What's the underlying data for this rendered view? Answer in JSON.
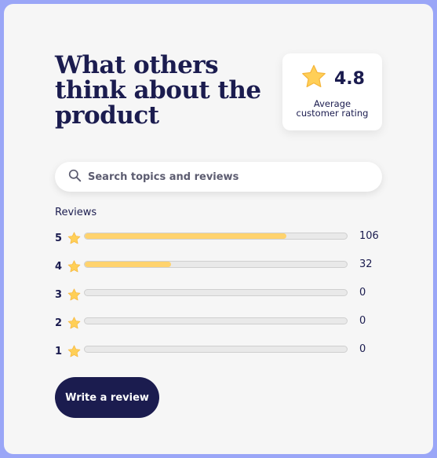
{
  "header": {
    "title": "What others think about the product"
  },
  "rating": {
    "value": "4.8",
    "caption_line1": "Average",
    "caption_line2": "customer rating",
    "icon": "star-icon"
  },
  "search": {
    "placeholder": "Search topics and reviews",
    "icon": "search-icon"
  },
  "reviews": {
    "label": "Reviews",
    "rows": [
      {
        "stars": "5",
        "count": "106",
        "fill_percent": 77
      },
      {
        "stars": "4",
        "count": "32",
        "fill_percent": 33
      },
      {
        "stars": "3",
        "count": "0",
        "fill_percent": 0
      },
      {
        "stars": "2",
        "count": "0",
        "fill_percent": 0
      },
      {
        "stars": "1",
        "count": "0",
        "fill_percent": 0
      }
    ]
  },
  "actions": {
    "write_review_label": "Write a review"
  },
  "colors": {
    "navy": "#1b1c4f",
    "star": "#ffcf57",
    "bar_fill": "#ffd36e",
    "bar_track": "#e9e9e9",
    "frame": "#9aa6f7",
    "card": "#f6f6f6"
  }
}
